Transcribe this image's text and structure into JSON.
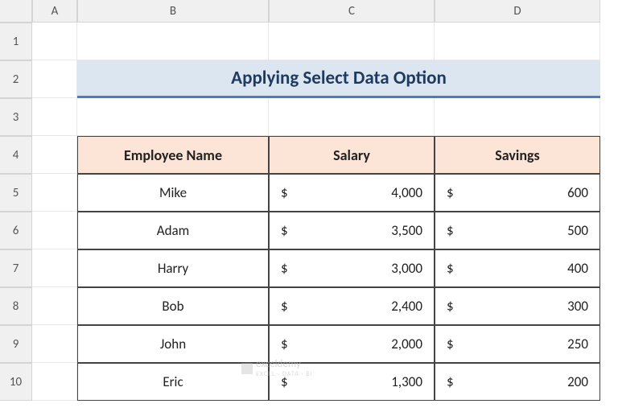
{
  "columns": [
    "A",
    "B",
    "C",
    "D"
  ],
  "rows": [
    "1",
    "2",
    "3",
    "4",
    "5",
    "6",
    "7",
    "8",
    "9",
    "10"
  ],
  "title": "Applying Select Data Option",
  "headers": {
    "name": "Employee Name",
    "salary": "Salary",
    "savings": "Savings"
  },
  "currency": "$",
  "employees": [
    {
      "name": "Mike",
      "salary": "4,000",
      "savings": "600"
    },
    {
      "name": "Adam",
      "salary": "3,500",
      "savings": "500"
    },
    {
      "name": "Harry",
      "salary": "3,000",
      "savings": "400"
    },
    {
      "name": "Bob",
      "salary": "2,400",
      "savings": "300"
    },
    {
      "name": "John",
      "salary": "2,000",
      "savings": "250"
    },
    {
      "name": "Eric",
      "salary": "1,300",
      "savings": "200"
    }
  ],
  "watermark": {
    "brand": "exceldemy",
    "tag": "EXCEL · DATA · BI"
  }
}
